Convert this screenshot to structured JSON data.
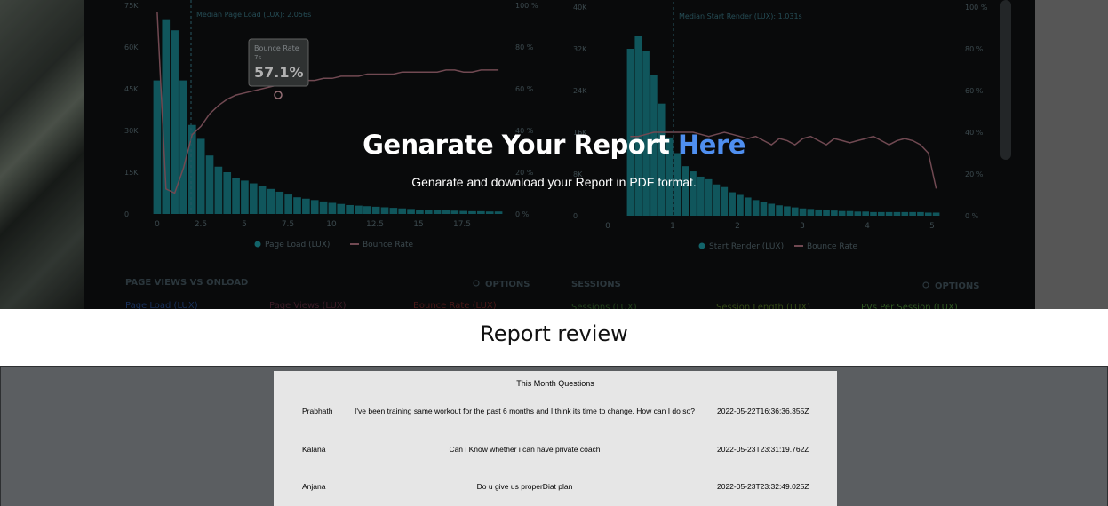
{
  "hero": {
    "title_main": "Genarate Your Report ",
    "title_accent": "Here",
    "subtitle": "Genarate and download your Report in PDF format.",
    "accent_color": "#4f8ff0",
    "background_dashboard": {
      "left_chart": {
        "y_ticks": [
          "75K",
          "60K",
          "45K",
          "30K",
          "15K",
          "0"
        ],
        "y2_ticks": [
          "100 %",
          "80 %",
          "60 %",
          "40 %",
          "20 %",
          "0 %"
        ],
        "x_ticks": [
          "0",
          "2.5",
          "5",
          "7.5",
          "10",
          "12.5",
          "15",
          "17.5"
        ],
        "median_label": "Median Page Load (LUX): 2.056s",
        "tooltip_title": "Bounce Rate",
        "tooltip_sub": "7s",
        "tooltip_value": "57.1%",
        "legend_a": "Page Load (LUX)",
        "legend_b": "Bounce Rate",
        "bars": [
          48,
          70,
          66,
          48,
          32,
          27,
          21,
          17,
          15,
          13,
          12,
          11,
          10,
          9,
          8,
          7,
          6,
          5.5,
          5,
          4.5,
          4,
          3.6,
          3.2,
          3,
          2.8,
          2.6,
          2.4,
          2.2,
          2,
          1.8,
          1.6,
          1.5,
          1.4,
          1.3,
          1.2,
          1.1,
          1,
          1,
          0.9,
          0.9
        ],
        "bounce_line": [
          0.97,
          0.12,
          0.1,
          0.22,
          0.38,
          0.42,
          0.48,
          0.52,
          0.55,
          0.57,
          0.58,
          0.59,
          0.6,
          0.61,
          0.62,
          0.62,
          0.63,
          0.64,
          0.64,
          0.65,
          0.65,
          0.66,
          0.66,
          0.66,
          0.67,
          0.67,
          0.67,
          0.67,
          0.68,
          0.68,
          0.68,
          0.68,
          0.68,
          0.69,
          0.69,
          0.68,
          0.68,
          0.69,
          0.69,
          0.69
        ]
      },
      "right_chart": {
        "y_ticks": [
          "40K",
          "32K",
          "24K",
          "16K",
          "8K",
          "0"
        ],
        "y2_ticks": [
          "100 %",
          "80 %",
          "60 %",
          "40 %",
          "20 %",
          "0 %"
        ],
        "x_ticks": [
          "0",
          "1",
          "2",
          "3",
          "4",
          "5"
        ],
        "median_label": "Median Start Render (LUX): 1.031s",
        "legend_a": "Start Render (LUX)",
        "legend_b": "Bounce Rate",
        "bars": [
          32,
          34.5,
          31.5,
          27,
          21.5,
          15,
          12,
          9.5,
          8.5,
          7.5,
          7,
          6,
          5.5,
          4.5,
          4,
          3.5,
          3,
          2.6,
          2.3,
          2,
          1.8,
          1.6,
          1.4,
          1.3,
          1.2,
          1.1,
          1,
          0.9,
          0.9,
          0.8,
          0.8,
          0.7,
          0.7,
          0.7,
          0.7,
          0.7,
          0.7,
          0.7,
          0.6,
          0.6
        ],
        "bounce_line": [
          0.38,
          0.38,
          0.39,
          0.4,
          0.4,
          0.4,
          0.4,
          0.4,
          0.4,
          0.39,
          0.38,
          0.39,
          0.4,
          0.39,
          0.38,
          0.37,
          0.38,
          0.36,
          0.34,
          0.37,
          0.36,
          0.34,
          0.37,
          0.38,
          0.36,
          0.34,
          0.37,
          0.36,
          0.35,
          0.36,
          0.37,
          0.38,
          0.36,
          0.34,
          0.36,
          0.37,
          0.36,
          0.34,
          0.3,
          0.13
        ]
      },
      "lower_headers": {
        "left_title": "PAGE VIEWS VS ONLOAD",
        "left_options": "OPTIONS",
        "right_title": "SESSIONS",
        "right_options": "OPTIONS",
        "left_cols": [
          "Page Load (LUX)",
          "Page Views (LUX)",
          "Bounce Rate (LUX)"
        ],
        "right_cols": [
          "Sessions (LUX)",
          "Session Length (LUX)",
          "PVs Per Session (LUX)"
        ]
      }
    }
  },
  "review": {
    "title": "Report revie",
    "title_dot_letter": "w"
  },
  "document": {
    "page_title": "This Month Questions",
    "rows": [
      {
        "name": "Prabhath",
        "question": "I've been training  same workout for the past 6 months and I think its time to change. How can I do so?",
        "time": "2022-05-22T16:36:36.355Z"
      },
      {
        "name": "Kalana",
        "question": "Can i Know whether i can have private coach",
        "time": "2022-05-23T23:31:19.762Z"
      },
      {
        "name": "Anjana",
        "question": "Do u give us properDiat plan",
        "time": "2022-05-23T23:32:49.025Z"
      }
    ]
  }
}
